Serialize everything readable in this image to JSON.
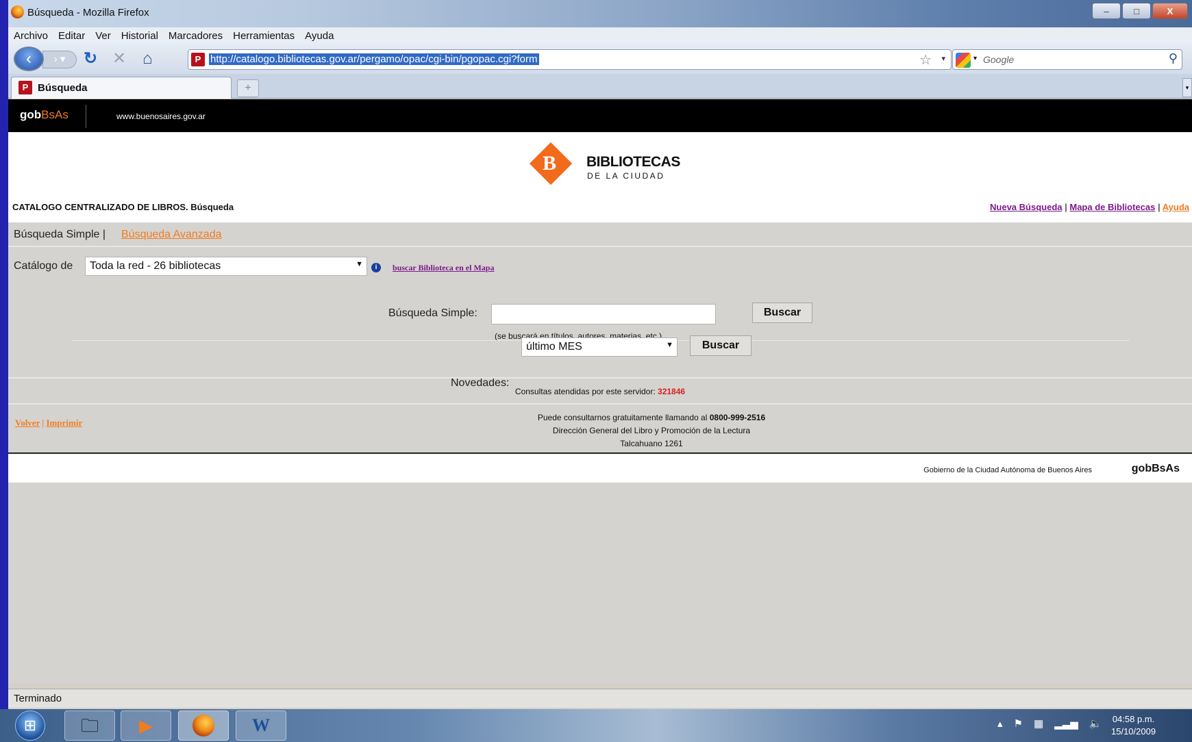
{
  "window": {
    "title": "Búsqueda - Mozilla Firefox",
    "minimize": "–",
    "maximize": "□",
    "close": "X"
  },
  "menu": [
    "Archivo",
    "Editar",
    "Ver",
    "Historial",
    "Marcadores",
    "Herramientas",
    "Ayuda"
  ],
  "nav": {
    "url": "http://catalogo.bibliotecas.gov.ar/pergamo/opac/cgi-bin/pgopac.cgi?form",
    "search_placeholder": "Google"
  },
  "tab": {
    "title": "Búsqueda",
    "new": "+"
  },
  "site": {
    "gob_a": "gob",
    "gob_b": "BsAs",
    "gob_url": "www.buenosaires.gov.ar",
    "logo_line1": "BIBLIOTECAS",
    "logo_line2": "DE LA CIUDAD",
    "catalog_title": "CATALOGO CENTRALIZADO DE LIBROS.  Búsqueda",
    "links": {
      "nueva": "Nueva Búsqueda",
      "mapa": "Mapa de Bibliotecas",
      "ayuda": "Ayuda"
    },
    "simple_label": "Búsqueda Simple |",
    "avanzada": "Búsqueda Avanzada",
    "catalogo_label": "Catálogo de",
    "catalogo_value": "Toda la red - 26 bibliotecas",
    "map_link": "buscar Biblioteca en el Mapa",
    "busqueda_label": "Búsqueda Simple:",
    "busqueda_value": "",
    "buscar": "Buscar",
    "hint": "(se buscará en títulos, autores, materias, etc.)",
    "novedades_label": "Novedades:",
    "novedades_value": "último MES",
    "consultas_label": "Consultas atendidas por este servidor:",
    "consultas_count": "321846",
    "volver": "Volver",
    "imprimir": "Imprimir",
    "foot_line1": "Puede consultarnos gratuitamente llamando al",
    "foot_phone": "0800-999-2516",
    "foot_line2": "Dirección General del Libro y Promoción de la Lectura",
    "foot_line3": "Talcahuano 1261",
    "gov_text": "Gobierno de la Ciudad Autónoma de Buenos Aires",
    "gov_logo": "gobBsAs"
  },
  "status": "Terminado",
  "clock": {
    "time": "04:58 p.m.",
    "date": "15/10/2009"
  },
  "colors": {
    "accent_orange": "#f07c22",
    "link_purple": "#7b1a8a",
    "count_red": "#d8201e"
  },
  "icons": [
    "firefox-icon",
    "back-arrow-icon",
    "reload-icon",
    "stop-icon",
    "home-icon",
    "star-icon",
    "google-icon",
    "search-icon",
    "info-icon",
    "windows-start-icon",
    "explorer-icon",
    "media-player-icon",
    "word-icon"
  ]
}
